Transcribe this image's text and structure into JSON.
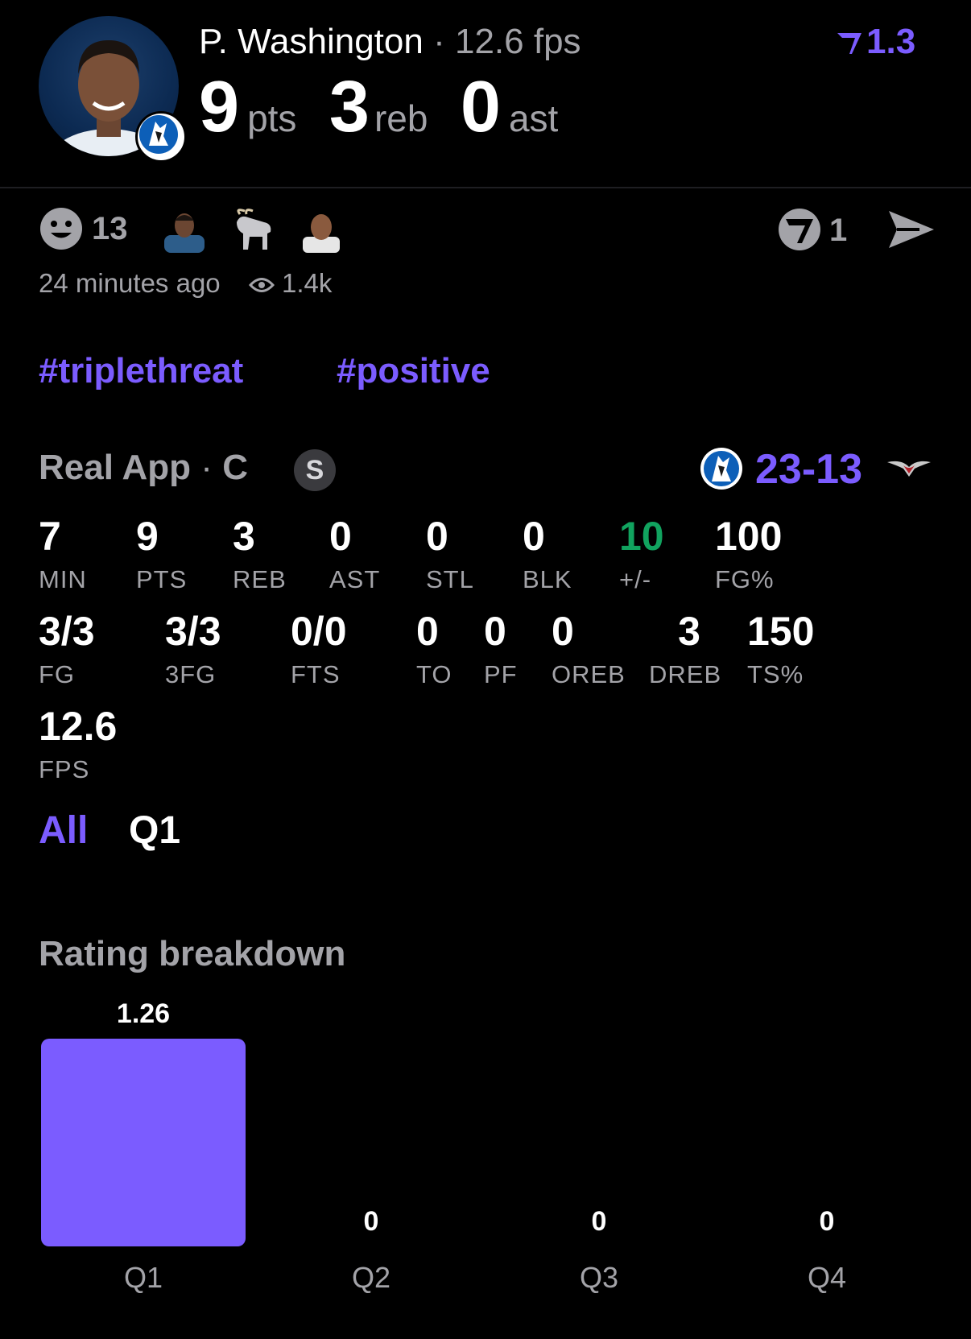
{
  "header": {
    "player_name": "P. Washington",
    "separator": "·",
    "fps_text": "12.6 fps",
    "rating": "1.3",
    "stats": [
      {
        "value": "9",
        "unit": "pts"
      },
      {
        "value": "3",
        "unit": "reb"
      },
      {
        "value": "0",
        "unit": "ast"
      }
    ]
  },
  "reactions": {
    "smiley_count": "13",
    "reactors": [
      "player-avatar",
      "goat-icon",
      "person-avatar"
    ],
    "shield_count": "1",
    "time_ago": "24 minutes ago",
    "views": "1.4k"
  },
  "hashtags": [
    "#triplethreat",
    "#positive"
  ],
  "league": {
    "name": "Real App",
    "separator": "·",
    "position": "C",
    "badge": "S",
    "score": "23-13"
  },
  "stats_rows": [
    [
      {
        "value": "7",
        "label": "MIN"
      },
      {
        "value": "9",
        "label": "PTS"
      },
      {
        "value": "3",
        "label": "REB"
      },
      {
        "value": "0",
        "label": "AST"
      },
      {
        "value": "0",
        "label": "STL"
      },
      {
        "value": "0",
        "label": "BLK"
      },
      {
        "value": "10",
        "label": "+/-"
      },
      {
        "value": "100",
        "label": "FG%"
      }
    ],
    [
      {
        "value": "3/3",
        "label": "FG"
      },
      {
        "value": "3/3",
        "label": "3FG"
      },
      {
        "value": "0/0",
        "label": "FTS"
      },
      {
        "value": "0",
        "label": "TO"
      },
      {
        "value": "0",
        "label": "PF"
      },
      {
        "value": "0",
        "label": "OREB"
      },
      {
        "value": "3",
        "label": "DREB"
      },
      {
        "value": "150",
        "label": "TS%"
      }
    ],
    [
      {
        "value": "12.6",
        "label": "FPS"
      }
    ]
  ],
  "tabs": [
    {
      "label": "All",
      "active": true
    },
    {
      "label": "Q1",
      "active": false
    }
  ],
  "rating_breakdown": {
    "title": "Rating breakdown"
  },
  "colors": {
    "accent": "#7b5cff",
    "positive": "#11a35f",
    "muted": "#a3a3a8",
    "background": "#000000"
  },
  "chart_data": {
    "type": "bar",
    "title": "Rating breakdown",
    "categories": [
      "Q1",
      "Q2",
      "Q3",
      "Q4"
    ],
    "values": [
      1.26,
      0,
      0,
      0
    ],
    "value_labels": [
      "1.26",
      "0",
      "0",
      "0"
    ],
    "ylim": [
      0,
      1.26
    ],
    "grid": false
  }
}
